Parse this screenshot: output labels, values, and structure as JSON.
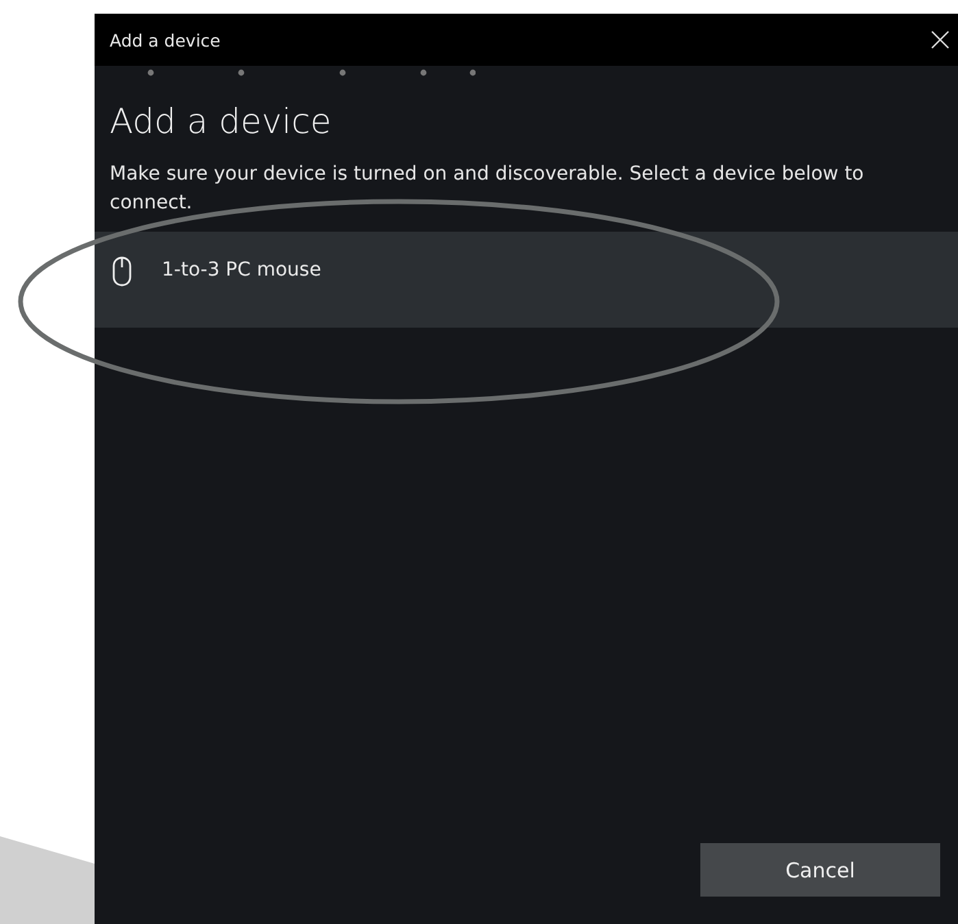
{
  "window": {
    "title": "Add a device"
  },
  "heading": "Add a device",
  "description": "Make sure your device is turned on and discoverable. Select a device below to connect.",
  "devices": [
    {
      "name": "1-to-3 PC mouse",
      "kind": "mouse",
      "selected": true
    }
  ],
  "buttons": [
    {
      "label": "Cancel"
    }
  ]
}
